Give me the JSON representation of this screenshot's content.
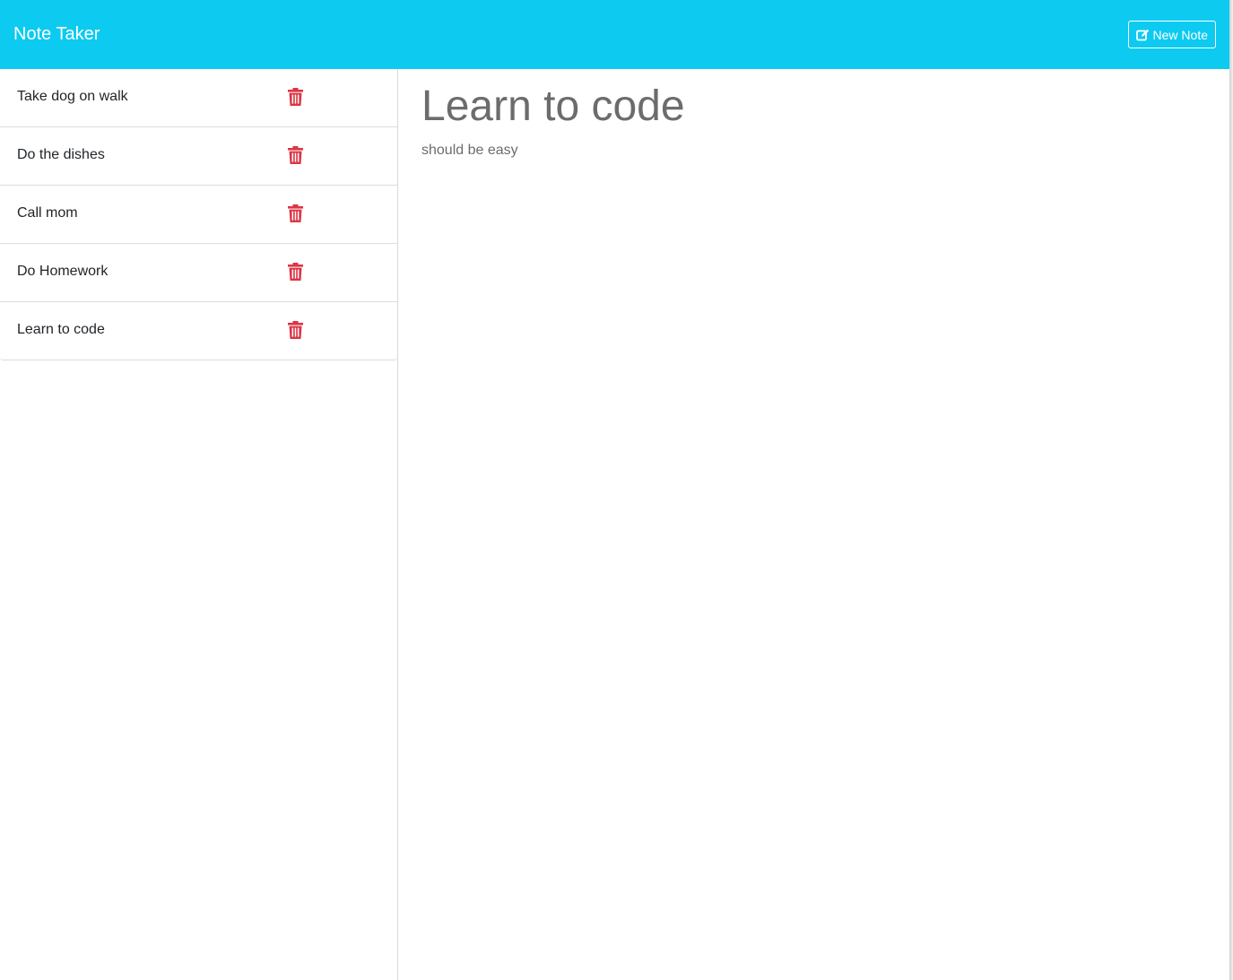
{
  "navbar": {
    "brand": "Note Taker",
    "new_note_label": "New Note",
    "background_color": "#0dcaf0"
  },
  "sidebar": {
    "notes": [
      {
        "title": "Take dog on walk"
      },
      {
        "title": "Do the dishes"
      },
      {
        "title": "Call mom"
      },
      {
        "title": "Do Homework"
      },
      {
        "title": "Learn to code"
      }
    ],
    "delete_icon_color": "#dc3545"
  },
  "main": {
    "active_note": {
      "title": "Learn to code",
      "text": "should be easy"
    }
  }
}
